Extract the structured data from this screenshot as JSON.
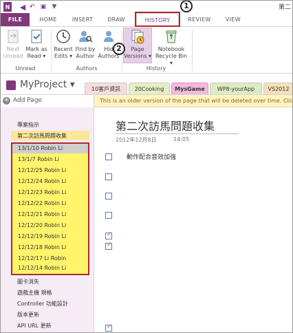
{
  "window": {
    "title": "第二"
  },
  "tabs": {
    "file": "FILE",
    "home": "HOME",
    "insert": "INSERT",
    "draw": "DRAW",
    "history": "HISTORY",
    "review": "REVIEW",
    "view": "VIEW"
  },
  "ribbon": {
    "unread": {
      "label": "Unread",
      "next_unread": [
        "Next",
        "Unread"
      ],
      "mark_as_read": [
        "Mark as",
        "Read ▾"
      ]
    },
    "authors": {
      "label": "Authors",
      "recent_edits": [
        "Recent",
        "Edits ▾"
      ],
      "find_by_author": [
        "Find by",
        "Author"
      ],
      "hide_authors": [
        "Hid",
        "Authors"
      ]
    },
    "history": {
      "label": "History",
      "page_versions": [
        "Page",
        "Versions ▾"
      ],
      "notebook_recycle_bin": [
        "Notebook",
        "Recycle Bin ▾"
      ]
    }
  },
  "callouts": {
    "one": "1",
    "two": "2"
  },
  "notebook": {
    "name": "MyProject ▾",
    "sections": [
      "10客戶資訊",
      "20Cooking",
      "MysGame",
      "WP8-yourApp",
      "VS2012"
    ]
  },
  "add_page_label": "Add Page",
  "banner_text": "This is an older version of the page that will be deleted over time. Click he",
  "pages": {
    "before": [
      "專案指示",
      "第二次訪馬問題收集"
    ],
    "versions": [
      "13/1/10 Robin Li",
      "13/1/7 Robin Li",
      "12/12/25 Robin Li",
      "12/12/24 Robin Li",
      "12/12/23 Robin Li",
      "12/12/22 Robin Li",
      "12/12/21 Robin Li",
      "12/12/20 Robin Li",
      "12/12/19 Robin Li",
      "12/12/18 Robin Li",
      "12/12/17 Li Robin",
      "12/12/14 Robin Li"
    ],
    "after": [
      "圖卡消失",
      "遊戲主機 規格",
      "Controller 功能設計",
      "版本更新",
      "API URL 更新"
    ]
  },
  "page_content": {
    "title": "第二次訪馬問題收集",
    "date": "2012年12月8日",
    "time": "14:05",
    "items": [
      "動作配合音效加強"
    ]
  }
}
